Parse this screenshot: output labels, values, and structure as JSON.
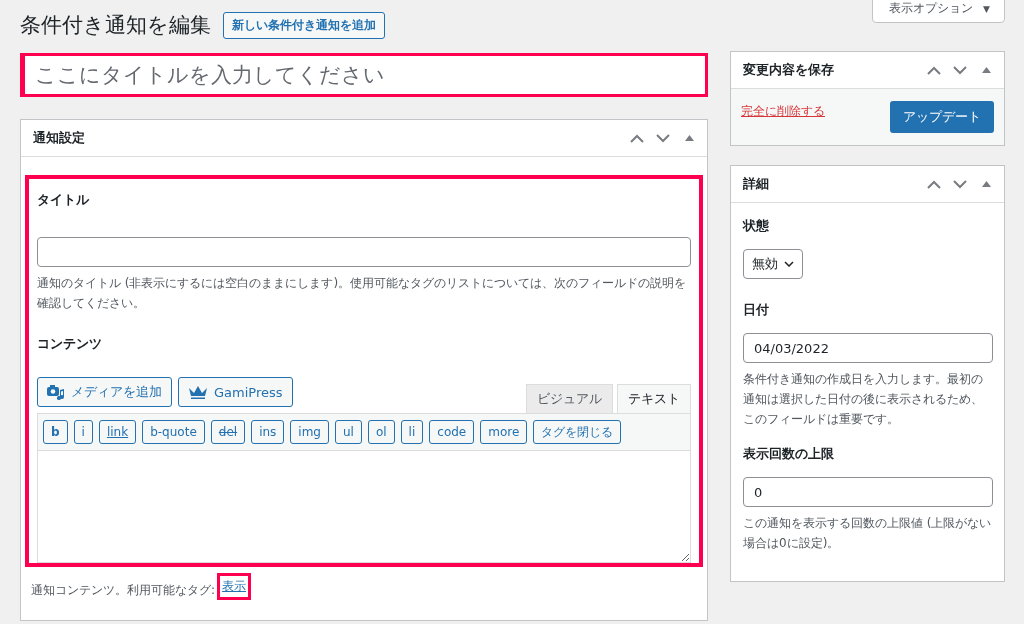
{
  "screen_options": {
    "label": "表示オプション",
    "caret": "▼"
  },
  "page": {
    "title": "条件付き通知を編集",
    "add_new": "新しい条件付き通知を追加"
  },
  "title_field": {
    "placeholder": "ここにタイトルを入力してください"
  },
  "settings_box": {
    "title": "通知設定",
    "title_label": "タイトル",
    "title_help": "通知のタイトル (非表示にするには空白のままにします)。使用可能なタグのリストについては、次のフィールドの説明を確認してください。",
    "content_label": "コンテンツ",
    "media_buttons": [
      {
        "label": "メディアを追加",
        "kind": "media"
      },
      {
        "label": "GamiPress",
        "kind": "crown"
      }
    ],
    "editor_tabs": [
      {
        "label": "ビジュアル",
        "selected": false
      },
      {
        "label": "テキスト",
        "selected": true
      }
    ],
    "quicktags": [
      {
        "label": "b",
        "kind": "bold"
      },
      {
        "label": "i",
        "kind": "plain"
      },
      {
        "label": "link",
        "kind": "link"
      },
      {
        "label": "b-quote",
        "kind": "plain"
      },
      {
        "label": "del",
        "kind": "del"
      },
      {
        "label": "ins",
        "kind": "plain"
      },
      {
        "label": "img",
        "kind": "plain"
      },
      {
        "label": "ul",
        "kind": "plain"
      },
      {
        "label": "ol",
        "kind": "plain"
      },
      {
        "label": "li",
        "kind": "plain"
      },
      {
        "label": "code",
        "kind": "plain"
      },
      {
        "label": "more",
        "kind": "plain"
      },
      {
        "label": "タグを閉じる",
        "kind": "plain"
      }
    ],
    "content_help": "通知コンテンツ。利用可能なタグ:",
    "show_link": "表示"
  },
  "publish_box": {
    "title": "変更内容を保存",
    "delete_link": "完全に削除する",
    "update_button": "アップデート"
  },
  "details_box": {
    "title": "詳細",
    "status_label": "状態",
    "status_value": "無効",
    "date_label": "日付",
    "date_value": "04/03/2022",
    "date_help": "条件付き通知の作成日を入力します。最初の通知は選択した日付の後に表示されるため、このフィールドは重要です。",
    "limit_label": "表示回数の上限",
    "limit_value": "0",
    "limit_help": "この通知を表示する回数の上限値 (上限がない場合は0に設定)。"
  }
}
